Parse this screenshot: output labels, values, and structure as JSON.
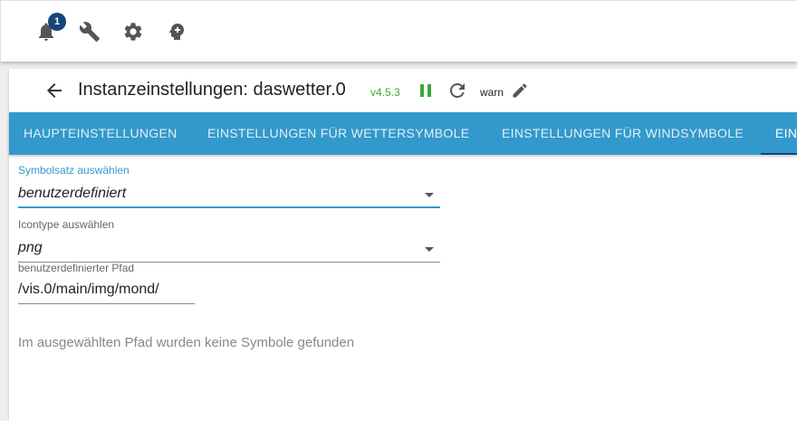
{
  "topbar": {
    "notification_count": "1",
    "icons": [
      "bell-icon",
      "wrench-icon",
      "gear-icon",
      "expert-head-icon"
    ]
  },
  "header": {
    "title": "Instanzeinstellungen: daswetter.0",
    "version": "v4.5.3",
    "log_level": "warn"
  },
  "tabs": [
    {
      "label": "HAUPTEINSTELLUNGEN",
      "active": false
    },
    {
      "label": "EINSTELLUNGEN FÜR WETTERSYMBOLE",
      "active": false
    },
    {
      "label": "EINSTELLUNGEN FÜR WINDSYMBOLE",
      "active": false
    },
    {
      "label": "EIN",
      "active": true
    }
  ],
  "form": {
    "symbol_set": {
      "label": "Symbolsatz auswählen",
      "value": "benutzerdefiniert"
    },
    "icon_type": {
      "label": "Icontype auswählen",
      "value": "png"
    },
    "custom_path": {
      "label": "benutzerdefinierter Pfad",
      "value": "/vis.0/main/img/mond/"
    }
  },
  "message": "Im ausgewählten Pfad wurden keine Symbole gefunden",
  "colors": {
    "tab_bar": "#3399cc",
    "tab_indicator": "#164477",
    "badge": "#164477",
    "running_green": "#3ca83c"
  }
}
